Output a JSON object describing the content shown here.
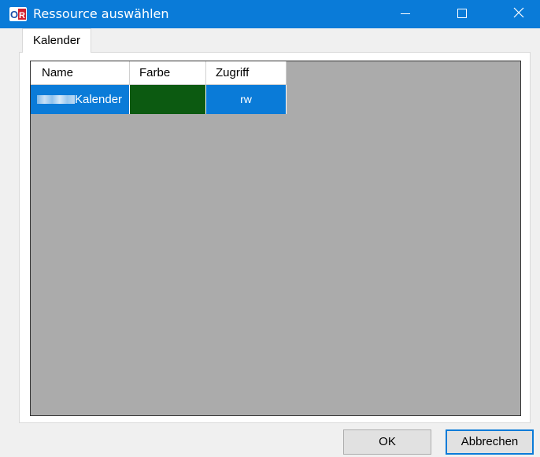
{
  "window": {
    "title": "Ressource auswählen",
    "accent_color": "#0a7bd8",
    "app_icon": "app-logo-icon",
    "controls": [
      "minimize-icon",
      "maximize-icon",
      "close-icon"
    ]
  },
  "tabs": [
    {
      "label": "Kalender",
      "selected": true
    }
  ],
  "grid": {
    "columns": [
      "Name",
      "Farbe",
      "Zugriff"
    ],
    "rows": [
      {
        "name": "Kalender",
        "name_prefix_redacted": true,
        "color": "#0c5a11",
        "access": "rw",
        "selected": true
      }
    ]
  },
  "buttons": {
    "ok_label": "OK",
    "cancel_label": "Abbrechen"
  }
}
